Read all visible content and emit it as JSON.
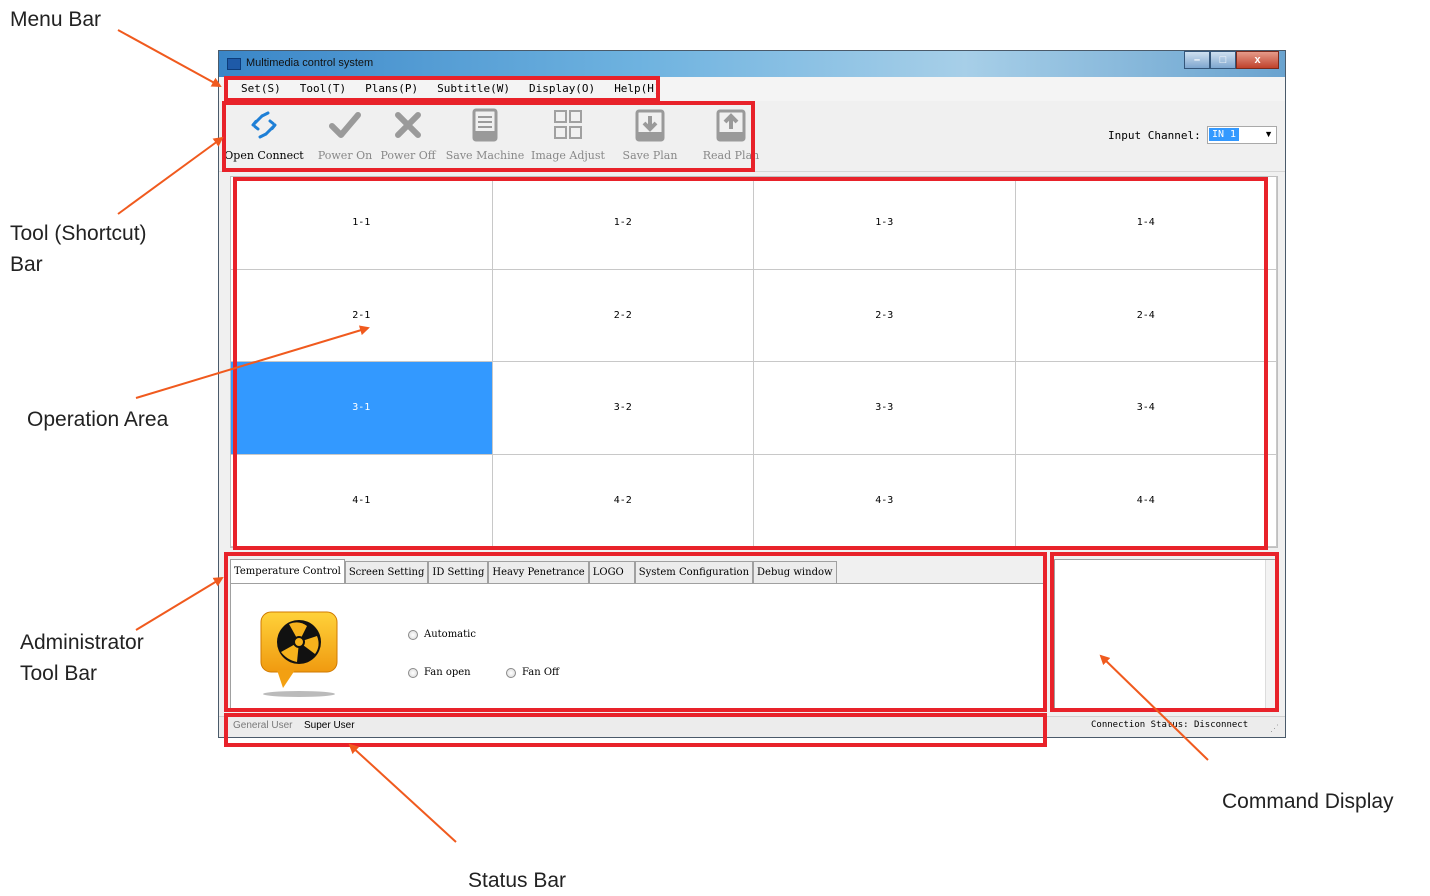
{
  "annotations": {
    "menu_bar": "Menu Bar",
    "tool_bar": "Tool (Shortcut) Bar",
    "operation_area": "Operation Area",
    "admin_tool_bar": "Administrator Tool Bar",
    "command_display": "Command Display",
    "status_bar": "Status Bar"
  },
  "window": {
    "title": "Multimedia control system",
    "controls": {
      "minimize": "–",
      "maximize": "□",
      "close": "x"
    }
  },
  "menus": [
    "Set(S)",
    "Tool(T)",
    "Plans(P)",
    "Subtitle(W)",
    "Display(O)",
    "Help(H)"
  ],
  "toolbar": {
    "tools": [
      {
        "label": "Open Connect",
        "icon": "connect-icon",
        "active": true
      },
      {
        "label": "Power On",
        "icon": "checkmark-icon",
        "active": false
      },
      {
        "label": "Power Off",
        "icon": "x-icon",
        "active": false
      },
      {
        "label": "Save Machine",
        "icon": "inbox-tray-icon",
        "active": false
      },
      {
        "label": "Image Adjust",
        "icon": "grid-squares-icon",
        "active": false
      },
      {
        "label": "Save Plan",
        "icon": "download-tray-icon",
        "active": false
      },
      {
        "label": "Read Plan",
        "icon": "upload-tray-icon",
        "active": false
      }
    ],
    "input_channel_label": "Input Channel:",
    "input_channel_value": "IN 1"
  },
  "grid": {
    "rows": 4,
    "cols": 4,
    "cells": [
      "1-1",
      "1-2",
      "1-3",
      "1-4",
      "2-1",
      "2-2",
      "2-3",
      "2-4",
      "3-1",
      "3-2",
      "3-3",
      "3-4",
      "4-1",
      "4-2",
      "4-3",
      "4-4"
    ],
    "selected": "3-1"
  },
  "admin_tabs": {
    "tabs": [
      "Temperature Control",
      "Screen Setting",
      "ID Setting",
      "Heavy Penetrance",
      "LOGO",
      "System Configuration",
      "Debug window"
    ],
    "active_tab": "Temperature Control",
    "radios": {
      "automatic": "Automatic",
      "fan_open": "Fan open",
      "fan_off": "Fan Off"
    }
  },
  "status_bar": {
    "general_user": "General User",
    "super_user": "Super User",
    "connection_status": "Connection Status:  Disconnect"
  },
  "colors": {
    "highlight": "#e8222a",
    "arrow": "#f05a1e",
    "selection": "#3399ff"
  }
}
